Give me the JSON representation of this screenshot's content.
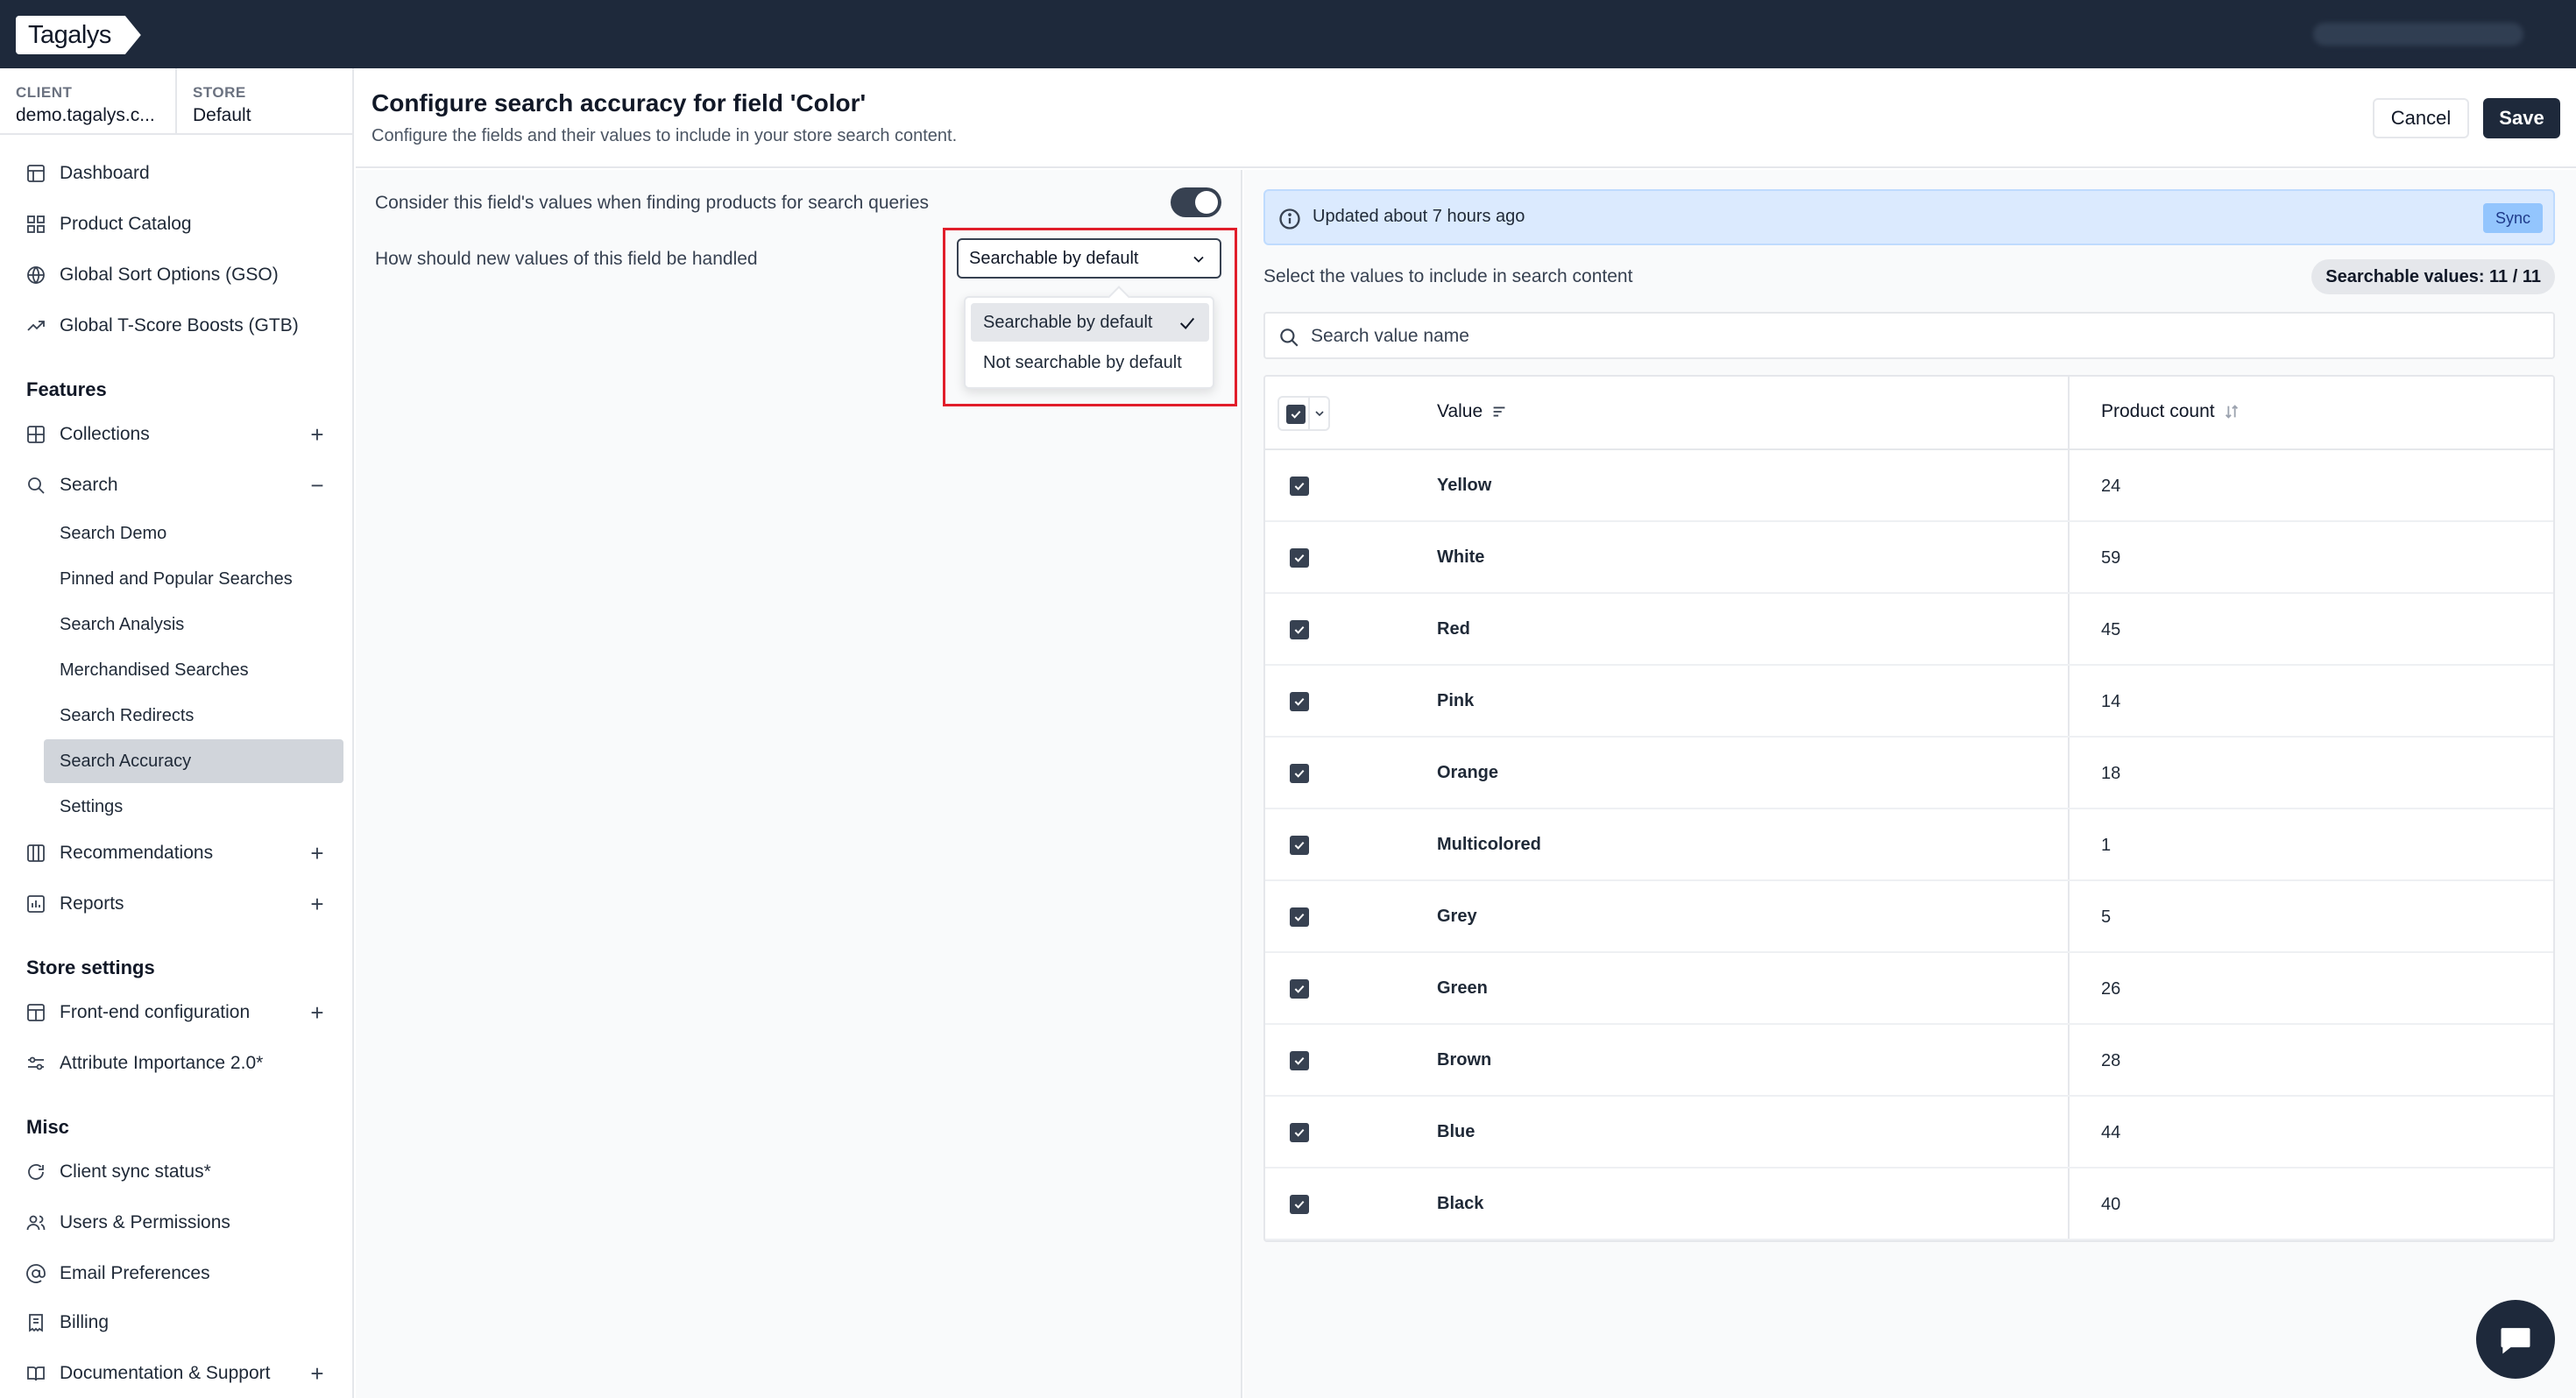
{
  "app": {
    "logo": "Tagalys"
  },
  "context": {
    "client_key": "CLIENT",
    "client_value": "demo.tagalys.c...",
    "store_key": "STORE",
    "store_value": "Default"
  },
  "nav": {
    "main": [
      {
        "label": "Dashboard",
        "icon": "dashboard-icon"
      },
      {
        "label": "Product Catalog",
        "icon": "grid-icon"
      },
      {
        "label": "Global Sort Options (GSO)",
        "icon": "globe-icon"
      },
      {
        "label": "Global T-Score Boosts (GTB)",
        "icon": "trend-up-icon"
      }
    ],
    "features_title": "Features",
    "features": {
      "collections": "Collections",
      "search": "Search",
      "search_sub": [
        "Search Demo",
        "Pinned and Popular Searches",
        "Search Analysis",
        "Merchandised Searches",
        "Search Redirects",
        "Search Accuracy",
        "Settings"
      ],
      "recommendations": "Recommendations",
      "reports": "Reports"
    },
    "store_settings_title": "Store settings",
    "store_settings": [
      "Front-end configuration",
      "Attribute Importance 2.0*"
    ],
    "misc_title": "Misc",
    "misc": [
      "Client sync status*",
      "Users & Permissions",
      "Email Preferences",
      "Billing",
      "Documentation & Support"
    ]
  },
  "header": {
    "title": "Configure search accuracy for field 'Color'",
    "subtitle": "Configure the fields and their values to include in your store search content.",
    "cancel_label": "Cancel",
    "save_label": "Save"
  },
  "settings": {
    "consider_label": "Consider this field's values when finding products for search queries",
    "consider_enabled": true,
    "new_values_label": "How should new values of this field be handled",
    "selected_option": "Searchable by default",
    "options": [
      "Searchable by default",
      "Not searchable by default"
    ]
  },
  "values_panel": {
    "info_text": "Updated about 7 hours ago",
    "sync_label": "Sync",
    "select_label": "Select the values to include in search content",
    "count_badge": "Searchable values: 11 / 11",
    "search_placeholder": "Search value name",
    "col_value": "Value",
    "col_count": "Product count",
    "rows": [
      {
        "value": "Yellow",
        "count": "24"
      },
      {
        "value": "White",
        "count": "59"
      },
      {
        "value": "Red",
        "count": "45"
      },
      {
        "value": "Pink",
        "count": "14"
      },
      {
        "value": "Orange",
        "count": "18"
      },
      {
        "value": "Multicolored",
        "count": "1"
      },
      {
        "value": "Grey",
        "count": "5"
      },
      {
        "value": "Green",
        "count": "26"
      },
      {
        "value": "Brown",
        "count": "28"
      },
      {
        "value": "Blue",
        "count": "44"
      },
      {
        "value": "Black",
        "count": "40"
      }
    ]
  },
  "colors": {
    "dark": "#1e293b",
    "highlight": "#e11d2a",
    "info_bg": "#dbeafe"
  }
}
